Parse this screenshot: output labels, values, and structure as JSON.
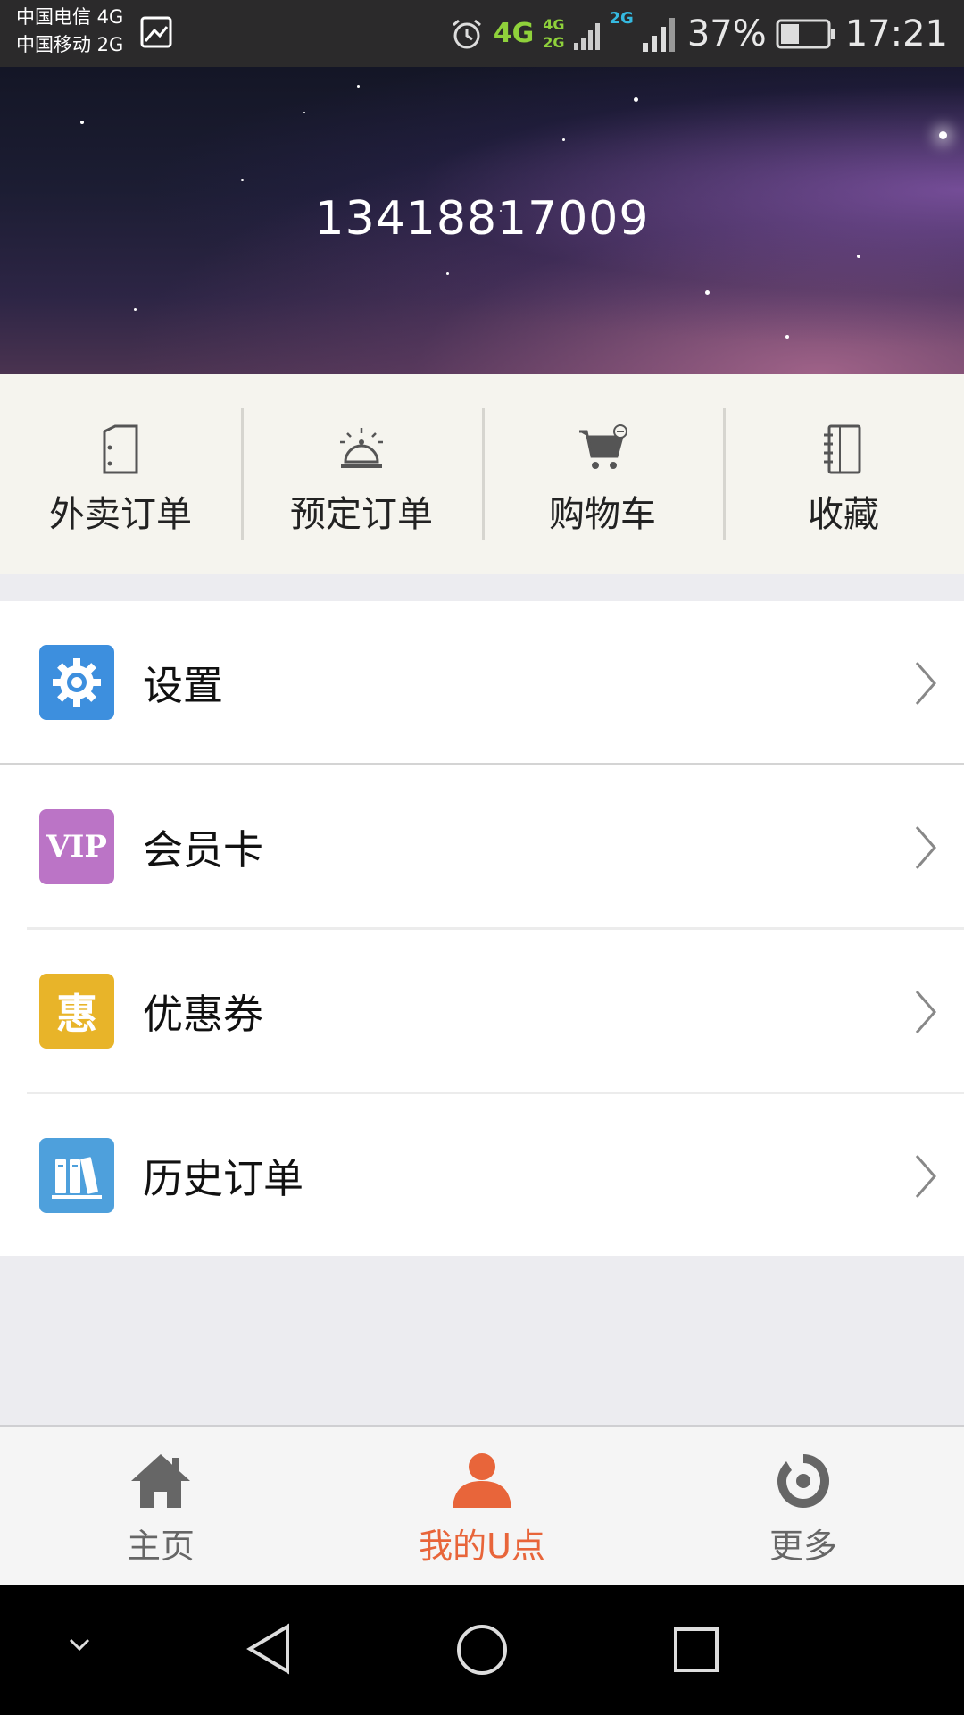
{
  "status_bar": {
    "carrier_1": "中国电信 4G",
    "carrier_2": "中国移动 2G",
    "net_main": "4G",
    "net_sub_top": "4G",
    "net_sub_bottom": "2G",
    "net_2g": "2G",
    "battery": "37%",
    "time": "17:21"
  },
  "header": {
    "phone": "13418817009"
  },
  "quick_actions": [
    {
      "label": "外卖订单",
      "icon": "delivery-order-icon"
    },
    {
      "label": "预定订单",
      "icon": "reservation-bell-icon"
    },
    {
      "label": "购物车",
      "icon": "shopping-cart-icon"
    },
    {
      "label": "收藏",
      "icon": "favorites-notebook-icon"
    }
  ],
  "menu": [
    {
      "label": "设置",
      "icon": "settings-gear-icon",
      "color": "#3d8fde"
    },
    {
      "label": "会员卡",
      "icon": "vip-icon",
      "badge_text": "VIP",
      "color": "#bb74c6"
    },
    {
      "label": "优惠券",
      "icon": "coupon-icon",
      "badge_text": "惠",
      "color": "#e8b429"
    },
    {
      "label": "历史订单",
      "icon": "history-books-icon",
      "color": "#4ea0dc"
    }
  ],
  "tabs": [
    {
      "label": "主页",
      "icon": "home-icon",
      "active": false
    },
    {
      "label": "我的U点",
      "icon": "user-icon",
      "active": true
    },
    {
      "label": "更多",
      "icon": "more-icon",
      "active": false
    }
  ],
  "colors": {
    "accent": "#e8653a",
    "inactive": "#666666"
  }
}
